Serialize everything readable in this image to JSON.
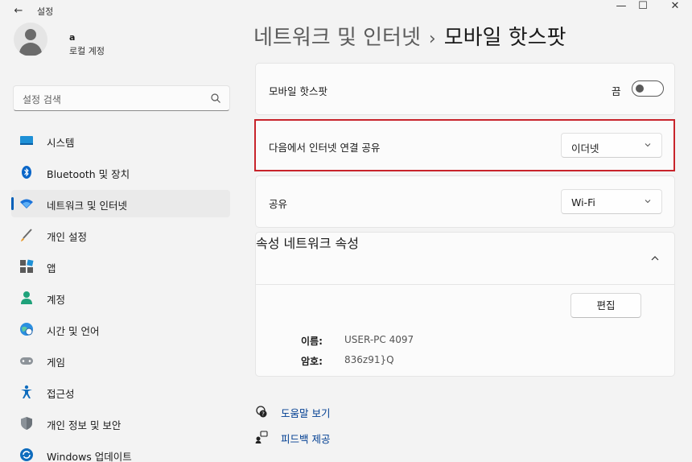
{
  "window": {
    "title": "설정",
    "back_icon": "←",
    "minimize_icon": "—",
    "maximize_icon": "☐",
    "close_icon": "✕"
  },
  "user": {
    "name": "a",
    "account_type": "로컬 계정"
  },
  "search": {
    "placeholder": "설정 검색"
  },
  "sidebar": {
    "items": [
      {
        "label": "시스템",
        "icon": "system-icon"
      },
      {
        "label": "Bluetooth 및 장치",
        "icon": "bluetooth-icon"
      },
      {
        "label": "네트워크 및 인터넷",
        "icon": "network-icon",
        "active": true
      },
      {
        "label": "개인 설정",
        "icon": "brush-icon"
      },
      {
        "label": "앱",
        "icon": "apps-icon"
      },
      {
        "label": "계정",
        "icon": "account-icon"
      },
      {
        "label": "시간 및 언어",
        "icon": "globe-icon"
      },
      {
        "label": "게임",
        "icon": "gamepad-icon"
      },
      {
        "label": "접근성",
        "icon": "accessibility-icon"
      },
      {
        "label": "개인 정보 및 보안",
        "icon": "shield-icon"
      },
      {
        "label": "Windows 업데이트",
        "icon": "update-icon"
      }
    ]
  },
  "header": {
    "breadcrumb_parent": "네트워크 및 인터넷",
    "separator": "›",
    "current": "모바일 핫스팟"
  },
  "settings": {
    "hotspot": {
      "label": "모바일 핫스팟",
      "state_label": "끔",
      "on": false
    },
    "share_from": {
      "label": "다음에서 인터넷 연결 공유",
      "value": "이더넷"
    },
    "share_over": {
      "label": "공유",
      "value": "Wi-Fi"
    },
    "properties": {
      "label": "속성",
      "network_properties_label": "네트워크 속성",
      "edit_button": "편집",
      "name_key": "이름:",
      "name_value": "USER-PC 4097",
      "password_key": "암호:",
      "password_value": "836z91}Q"
    }
  },
  "footer": {
    "help_label": "도움말 보기",
    "feedback_label": "피드백 제공"
  },
  "colors": {
    "accent": "#005fb8",
    "highlight": "#c8242b"
  }
}
